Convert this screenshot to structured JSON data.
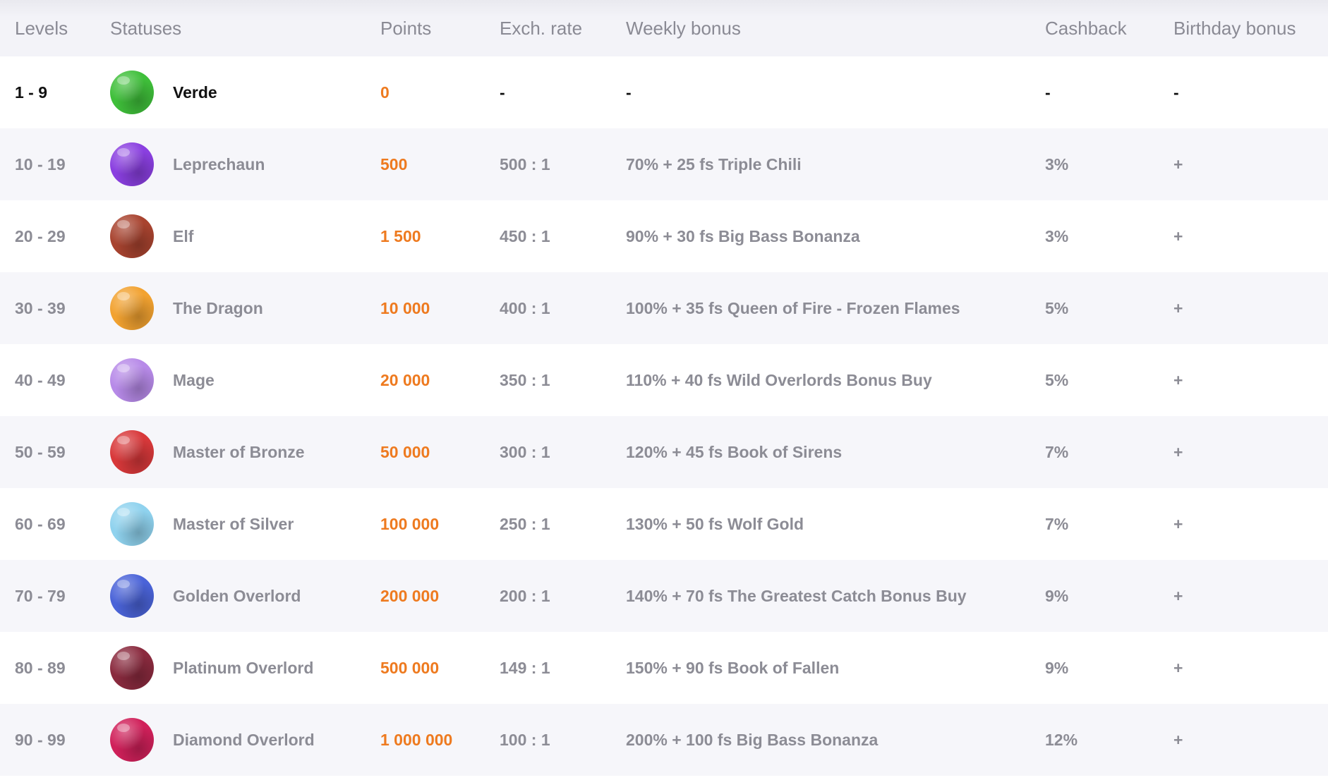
{
  "header": {
    "levels": "Levels",
    "statuses": "Statuses",
    "points": "Points",
    "rate": "Exch. rate",
    "weekly": "Weekly bonus",
    "cashback": "Cashback",
    "birthday": "Birthday bonus"
  },
  "rows": [
    {
      "levels": "1 - 9",
      "status": "Verde",
      "points": "0",
      "rate": "-",
      "weekly": "-",
      "cashback": "-",
      "birthday": "-",
      "icon": "green-planet-icon",
      "color": "#3fbf3a"
    },
    {
      "levels": "10 - 19",
      "status": "Leprechaun",
      "points": "500",
      "rate": "500 : 1",
      "weekly": "70% + 25 fs Triple Chili",
      "cashback": "3%",
      "birthday": "+",
      "icon": "purple-swirl-planet-icon",
      "color": "#8a3fe0"
    },
    {
      "levels": "20 - 29",
      "status": "Elf",
      "points": "1 500",
      "rate": "450 : 1",
      "weekly": "90% + 30 fs Big Bass Bonanza",
      "cashback": "3%",
      "birthday": "+",
      "icon": "rock-planet-icon",
      "color": "#a8432f"
    },
    {
      "levels": "30 - 39",
      "status": "The Dragon",
      "points": "10 000",
      "rate": "400 : 1",
      "weekly": "100% + 35 fs Queen of Fire - Frozen Flames",
      "cashback": "5%",
      "birthday": "+",
      "icon": "orange-bubbles-planet-icon",
      "color": "#f2a230"
    },
    {
      "levels": "40 - 49",
      "status": "Mage",
      "points": "20 000",
      "rate": "350 : 1",
      "weekly": "110% + 40 fs Wild Overlords Bonus Buy",
      "cashback": "5%",
      "birthday": "+",
      "icon": "lilac-moon-planet-icon",
      "color": "#b78ae8"
    },
    {
      "levels": "50 - 59",
      "status": "Master of Bronze",
      "points": "50 000",
      "rate": "300 : 1",
      "weekly": "120% + 45 fs Book of Sirens",
      "cashback": "7%",
      "birthday": "+",
      "icon": "red-lava-planet-icon",
      "color": "#d8383a"
    },
    {
      "levels": "60 - 69",
      "status": "Master of Silver",
      "points": "100 000",
      "rate": "250 : 1",
      "weekly": "130% + 50 fs Wolf Gold",
      "cashback": "7%",
      "birthday": "+",
      "icon": "light-blue-planet-icon",
      "color": "#8fd2ee"
    },
    {
      "levels": "70 - 79",
      "status": "Golden Overlord",
      "points": "200 000",
      "rate": "200 : 1",
      "weekly": "140% + 70 fs The Greatest Catch Bonus Buy",
      "cashback": "9%",
      "birthday": "+",
      "icon": "blue-purple-planet-icon",
      "color": "#4a63d8"
    },
    {
      "levels": "80 - 89",
      "status": "Platinum Overlord",
      "points": "500 000",
      "rate": "149 : 1",
      "weekly": "150% + 90 fs Book of Fallen",
      "cashback": "9%",
      "birthday": "+",
      "icon": "maroon-cracked-planet-icon",
      "color": "#8a2a3e"
    },
    {
      "levels": "90 - 99",
      "status": "Diamond Overlord",
      "points": "1 000 000",
      "rate": "100 : 1",
      "weekly": "200% + 100 fs Big Bass Bonanza",
      "cashback": "12%",
      "birthday": "+",
      "icon": "magenta-spotted-planet-icon",
      "color": "#d0205a"
    }
  ]
}
